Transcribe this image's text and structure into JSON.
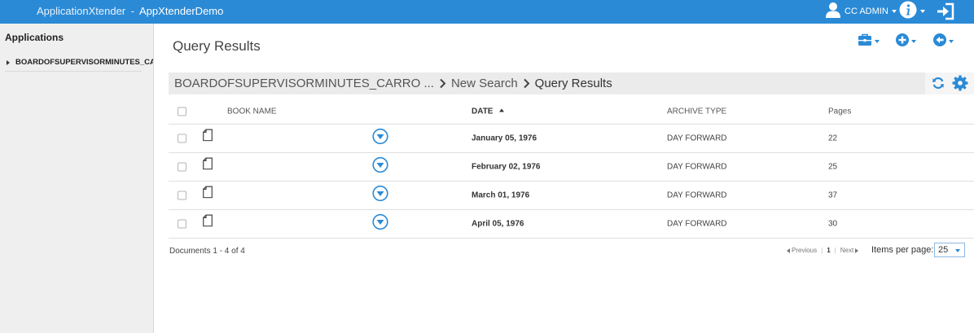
{
  "header": {
    "app_name": "ApplicationXtender",
    "separator": "-",
    "app_instance": "AppXtenderDemo",
    "user_name": "CC ADMIN",
    "brand_color": "#2a8ad6"
  },
  "sidebar": {
    "title": "Applications",
    "items": [
      {
        "label": "BOARDOFSUPERVISORMINUTES_CA"
      }
    ]
  },
  "main": {
    "title": "Query Results",
    "toolbar": {
      "icons": [
        "toolbox-icon",
        "add-circle-icon",
        "back-circle-icon"
      ]
    },
    "breadcrumb": [
      {
        "label": "BOARDOFSUPERVISORMINUTES_CARRO ..."
      },
      {
        "label": "New Search"
      },
      {
        "label": "Query Results"
      }
    ]
  },
  "table": {
    "columns": {
      "book_name": "BOOK NAME",
      "date": "DATE",
      "archive_type": "ARCHIVE TYPE",
      "pages": "Pages"
    },
    "sort": {
      "column": "date",
      "direction": "ascending"
    },
    "rows": [
      {
        "book_name": "",
        "date": "January 05, 1976",
        "archive_type": "DAY FORWARD",
        "pages": "22"
      },
      {
        "book_name": "",
        "date": "February 02, 1976",
        "archive_type": "DAY FORWARD",
        "pages": "25"
      },
      {
        "book_name": "",
        "date": "March 01, 1976",
        "archive_type": "DAY FORWARD",
        "pages": "37"
      },
      {
        "book_name": "",
        "date": "April 05, 1976",
        "archive_type": "DAY FORWARD",
        "pages": "30"
      }
    ]
  },
  "footer": {
    "doc_count": "Documents 1 - 4 of 4",
    "previous_label": "Previous",
    "current_page": "1",
    "next_label": "Next",
    "items_per_page_label": "Items per page:",
    "items_per_page_value": "25"
  }
}
